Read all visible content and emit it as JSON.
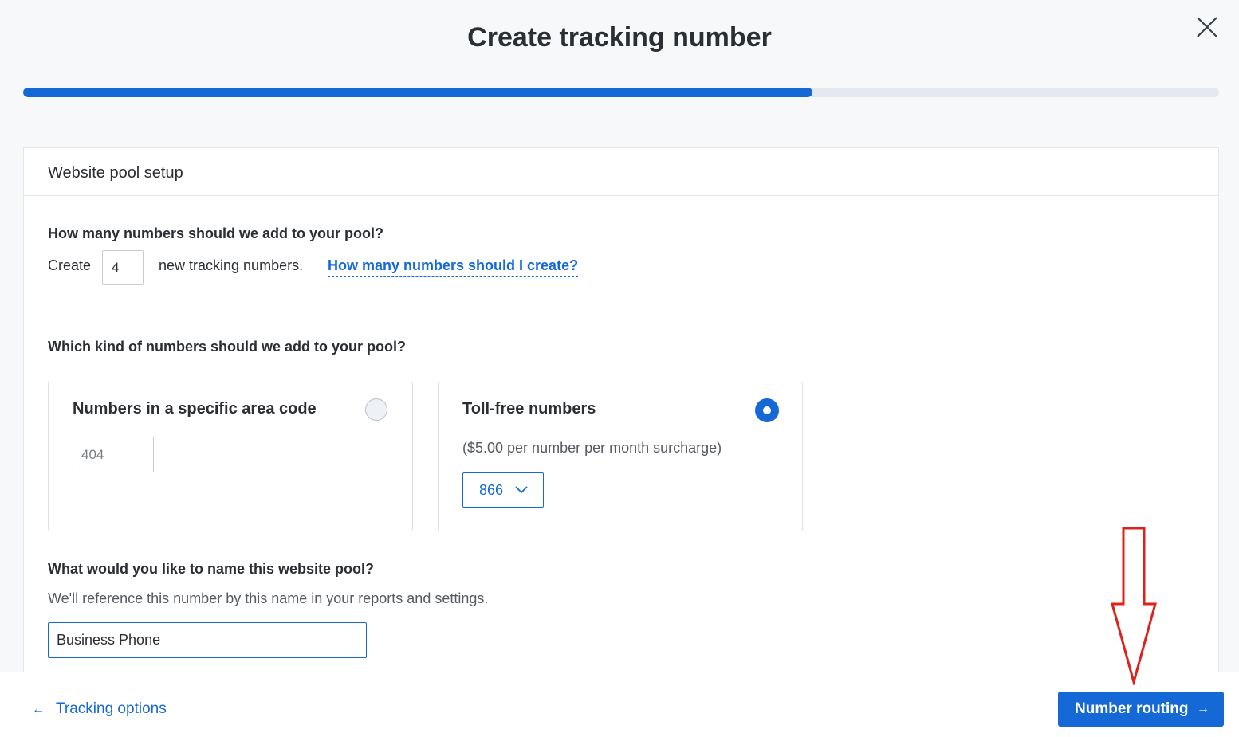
{
  "header": {
    "title": "Create tracking number",
    "progress_fraction": 0.66
  },
  "panel": {
    "title": "Website pool setup",
    "count_question": "How many numbers should we add to your pool?",
    "create_label": "Create",
    "count_value": "4",
    "count_suffix": "new tracking numbers.",
    "help_link": "How many numbers should I create?",
    "kind_question": "Which kind of numbers should we add to your pool?",
    "option_area": {
      "title": "Numbers in a specific area code",
      "placeholder": "404",
      "selected": false
    },
    "option_tollfree": {
      "title": "Toll-free numbers",
      "surcharge": "($5.00 per number per month surcharge)",
      "prefix": "866",
      "selected": true
    },
    "name_question": "What would you like to name this website pool?",
    "name_hint": "We'll reference this number by this name in your reports and settings.",
    "name_value": "Business Phone"
  },
  "footer": {
    "back_label": "Tracking options",
    "next_label": "Number routing"
  },
  "colors": {
    "accent": "#1569d6",
    "annotation": "#e0201b"
  }
}
